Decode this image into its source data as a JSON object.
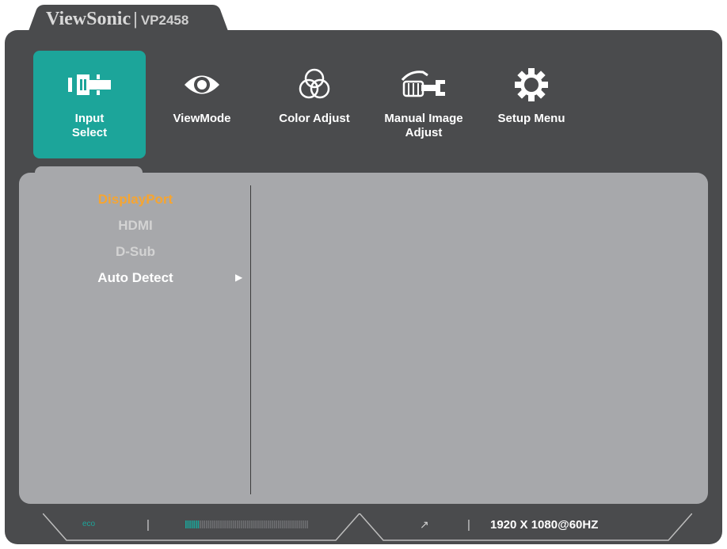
{
  "header": {
    "brand": "ViewSonic",
    "separator": "|",
    "model": "VP2458"
  },
  "tabs": [
    {
      "label": "Input Select",
      "icon": "input-select-icon",
      "active": true
    },
    {
      "label": "ViewMode",
      "icon": "eye-icon",
      "active": false
    },
    {
      "label": "Color Adjust",
      "icon": "color-circles-icon",
      "active": false
    },
    {
      "label": "Manual Image Adjust",
      "icon": "hand-wrench-icon",
      "active": false
    },
    {
      "label": "Setup Menu",
      "icon": "gear-icon",
      "active": false
    }
  ],
  "input_options": [
    {
      "label": "DisplayPort",
      "state": "selected"
    },
    {
      "label": "HDMI",
      "state": "disabled"
    },
    {
      "label": "D-Sub",
      "state": "disabled"
    },
    {
      "label": "Auto Detect",
      "state": "enabled",
      "has_submenu": true
    }
  ],
  "status_bar": {
    "eco_label": "eco",
    "separator": "|",
    "level_value": 0.12,
    "input_icon": "external-input-icon",
    "resolution": "1920 X 1080@60HZ"
  },
  "colors": {
    "panel_bg": "#4a4b4d",
    "accent": "#1ca59a",
    "content_bg": "#a7a8ab",
    "selected_text": "#f6a531"
  }
}
